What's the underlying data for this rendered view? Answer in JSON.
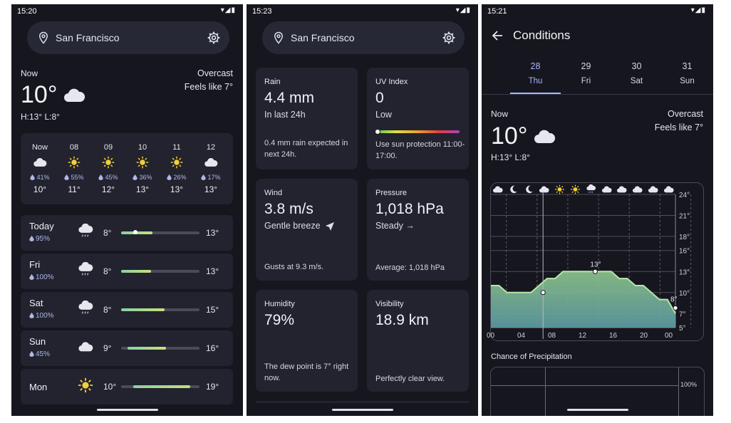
{
  "p1": {
    "status_time": "15:20",
    "city": "San Francisco",
    "now_label": "Now",
    "now_temp": "10°",
    "hi_lo": "H:13° L:8°",
    "condition": "Overcast",
    "feels": "Feels like 7°",
    "hourly": [
      {
        "time": "Now",
        "icon": "cloud-icon",
        "precip": "41%",
        "temp": "10°"
      },
      {
        "time": "08",
        "icon": "sun-icon",
        "precip": "55%",
        "temp": "11°"
      },
      {
        "time": "09",
        "icon": "sun-icon",
        "precip": "45%",
        "temp": "12°"
      },
      {
        "time": "10",
        "icon": "sun-icon",
        "precip": "36%",
        "temp": "13°"
      },
      {
        "time": "11",
        "icon": "sun-icon",
        "precip": "26%",
        "temp": "13°"
      },
      {
        "time": "12",
        "icon": "cloud-icon",
        "precip": "17%",
        "temp": "13°"
      }
    ],
    "daily": [
      {
        "day": "Today",
        "precip": "95%",
        "icon": "rain-cloud-icon",
        "lo": "8°",
        "hi": "13°",
        "fill_start": 0.0,
        "fill_end": 0.4,
        "now_marker": 0.15
      },
      {
        "day": "Fri",
        "precip": "100%",
        "icon": "rain-cloud-icon",
        "lo": "8°",
        "hi": "13°",
        "fill_start": 0.0,
        "fill_end": 0.38
      },
      {
        "day": "Sat",
        "precip": "100%",
        "icon": "rain-cloud-icon",
        "lo": "8°",
        "hi": "15°",
        "fill_start": 0.0,
        "fill_end": 0.55
      },
      {
        "day": "Sun",
        "precip": "45%",
        "icon": "cloud-icon",
        "lo": "9°",
        "hi": "16°",
        "fill_start": 0.08,
        "fill_end": 0.57
      },
      {
        "day": "Mon",
        "precip": "",
        "icon": "sun-icon",
        "lo": "10°",
        "hi": "19°",
        "fill_start": 0.15,
        "fill_end": 0.88
      }
    ]
  },
  "p2": {
    "status_time": "15:23",
    "city": "San Francisco",
    "cards": [
      {
        "title": "Rain",
        "value": "4.4 mm",
        "sub": "In last 24h",
        "desc": "0.4 mm rain expected in next 24h."
      },
      {
        "title": "UV Index",
        "value": "0",
        "sub": "Low",
        "desc": "Use sun protection 11:00-17:00."
      },
      {
        "title": "Wind",
        "value": "3.8 m/s",
        "sub": "Gentle breeze",
        "desc": "Gusts at 9.3 m/s."
      },
      {
        "title": "Pressure",
        "value": "1,018 hPa",
        "sub": "Steady →",
        "desc": "Average: 1,018 hPa"
      },
      {
        "title": "Humidity",
        "value": "79%",
        "sub": "",
        "desc": "The dew point is 7° right now."
      },
      {
        "title": "Visibility",
        "value": "18.9 km",
        "sub": "",
        "desc": "Perfectly clear view."
      }
    ]
  },
  "p3": {
    "status_time": "15:21",
    "title": "Conditions",
    "tabs": [
      {
        "num": "28",
        "day": "Thu",
        "selected": true
      },
      {
        "num": "29",
        "day": "Fri",
        "selected": false
      },
      {
        "num": "30",
        "day": "Sat",
        "selected": false
      },
      {
        "num": "31",
        "day": "Sun",
        "selected": false
      }
    ],
    "now_label": "Now",
    "now_temp": "10°",
    "hi_lo": "H:13° L:8°",
    "condition": "Overcast",
    "feels": "Feels like 7°",
    "precip_title": "Chance of Precipitation",
    "precip_tick": "100%"
  },
  "chart_data": {
    "type": "area",
    "x": [
      0,
      1,
      2,
      3,
      4,
      5,
      6,
      7,
      8,
      9,
      10,
      11,
      12,
      13,
      14,
      15,
      16,
      17,
      18,
      19,
      20,
      21,
      22,
      23
    ],
    "values": [
      11,
      11,
      10,
      10,
      10,
      10,
      11,
      12,
      12,
      13,
      13,
      13,
      13,
      13,
      13,
      13,
      12,
      12,
      11,
      11,
      10,
      9,
      9,
      7
    ],
    "xtick_labels": [
      "00",
      "04",
      "08",
      "12",
      "16",
      "20",
      "00"
    ],
    "ytick_labels": [
      "24°",
      "21°",
      "18°",
      "16°",
      "13°",
      "10°",
      "7°",
      "5°"
    ],
    "ylim": [
      5,
      24
    ],
    "annotations": [
      "13°",
      "8°"
    ],
    "hour_icons": [
      "cloud-icon",
      "moon-icon",
      "moon-icon",
      "cloud-icon",
      "sun-icon",
      "sun-icon",
      "rain-cloud-icon",
      "cloud-icon",
      "cloud-icon",
      "cloud-icon",
      "cloud-icon",
      "cloud-icon"
    ]
  },
  "colors": {
    "background": "#16161f",
    "card": "#22232f",
    "accent": "#a9b4ff",
    "precip": "#b0b8e8",
    "sun": "#f2cf3b"
  }
}
